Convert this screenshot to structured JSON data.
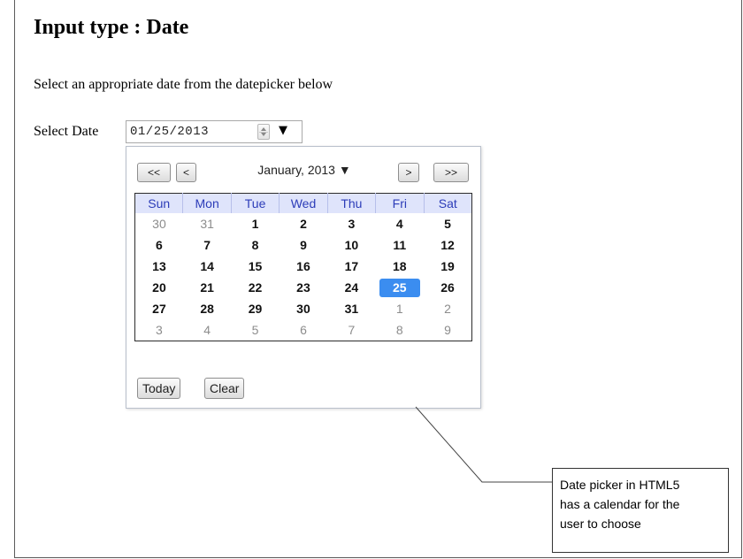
{
  "page": {
    "title": "Input type : Date",
    "instruction": "Select an appropriate date from the datepicker below"
  },
  "form": {
    "label": "Select Date",
    "value": "01/25/2013",
    "dropdown_glyph": "▼"
  },
  "datepicker": {
    "nav": {
      "prev_year": "<<",
      "prev_month": "<",
      "next_month": ">",
      "next_year": ">>"
    },
    "month_label": "January, 2013 ▼",
    "weekdays": [
      "Sun",
      "Mon",
      "Tue",
      "Wed",
      "Thu",
      "Fri",
      "Sat"
    ],
    "weeks": [
      [
        "30",
        "31",
        "1",
        "2",
        "3",
        "4",
        "5"
      ],
      [
        "6",
        "7",
        "8",
        "9",
        "10",
        "11",
        "12"
      ],
      [
        "13",
        "14",
        "15",
        "16",
        "17",
        "18",
        "19"
      ],
      [
        "20",
        "21",
        "22",
        "23",
        "24",
        "25",
        "26"
      ],
      [
        "27",
        "28",
        "29",
        "30",
        "31",
        "1",
        "2"
      ],
      [
        "3",
        "4",
        "5",
        "6",
        "7",
        "8",
        "9"
      ]
    ],
    "selected_day": "25",
    "today_label": "Today",
    "clear_label": "Clear",
    "colors": {
      "header_bg": "#dfe4fb",
      "header_text": "#2c3cb8",
      "selected_bg": "#3b8df0",
      "other_month_text": "#8c8c8c"
    }
  },
  "callout": {
    "lines": [
      "Date picker in HTML5",
      "has a calendar for the",
      "user to choose"
    ]
  }
}
